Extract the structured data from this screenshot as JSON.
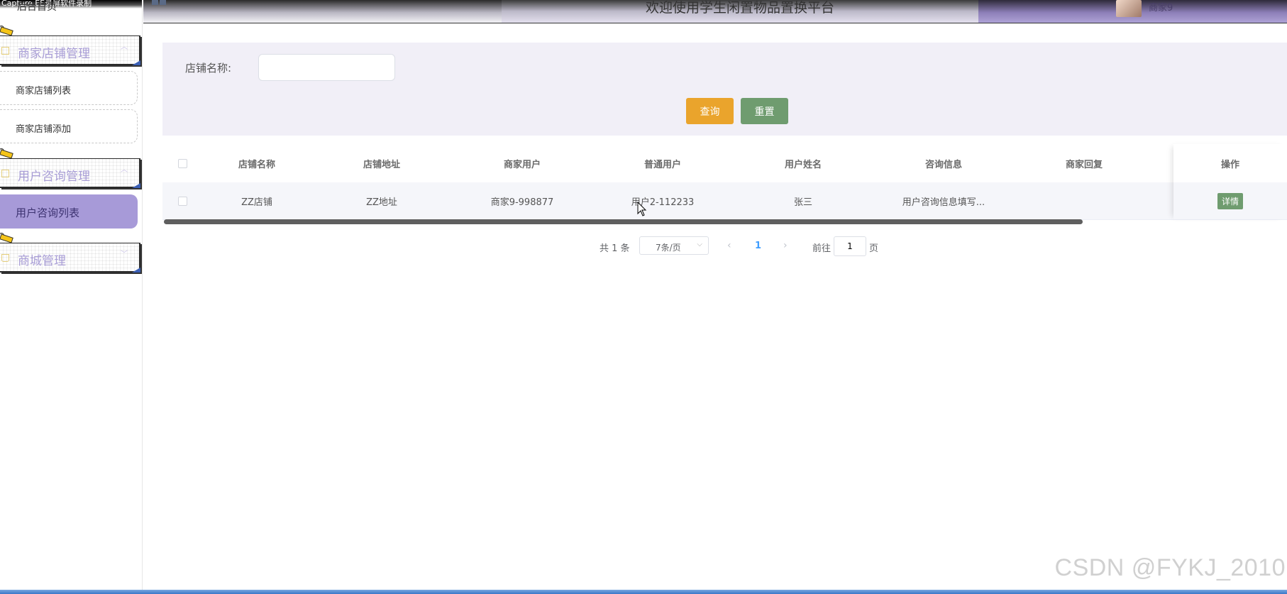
{
  "header": {
    "capture_text": "Capture EE录屏软件录制",
    "home_link": "后台首页",
    "title": "欢迎使用学生闲置物品置换平台",
    "username": "商家9"
  },
  "sidebar": {
    "groups": [
      {
        "label": "商家店铺管理",
        "items": [
          "商家店铺列表",
          "商家店铺添加"
        ]
      },
      {
        "label": "用户咨询管理",
        "items": [
          "用户咨询列表"
        ]
      },
      {
        "label": "商城管理",
        "items": []
      }
    ],
    "active_item": "用户咨询列表"
  },
  "search": {
    "label": "店铺名称:",
    "value": "",
    "query_button": "查询",
    "reset_button": "重置"
  },
  "table": {
    "columns": [
      "店铺名称",
      "店铺地址",
      "商家用户",
      "普通用户",
      "用户姓名",
      "咨询信息",
      "商家回复",
      "操作"
    ],
    "rows": [
      {
        "shop_name": "ZZ店铺",
        "shop_address": "ZZ地址",
        "merchant_user": "商家9-998877",
        "normal_user": "用户2-112233",
        "user_name": "张三",
        "consult_info": "用户咨询信息填写...",
        "merchant_reply": "",
        "action": "详情"
      }
    ]
  },
  "pagination": {
    "total": "共 1 条",
    "page_size": "7条/页",
    "current_page": "1",
    "goto_label": "前往",
    "goto_value": "1",
    "page_unit": "页"
  },
  "watermark": "CSDN @FYKJ_2010",
  "colors": {
    "accent_purple": "#a79ad8",
    "query_button": "#eaa42c",
    "reset_button": "#6f9c6f",
    "search_panel": "#f1eff7"
  }
}
